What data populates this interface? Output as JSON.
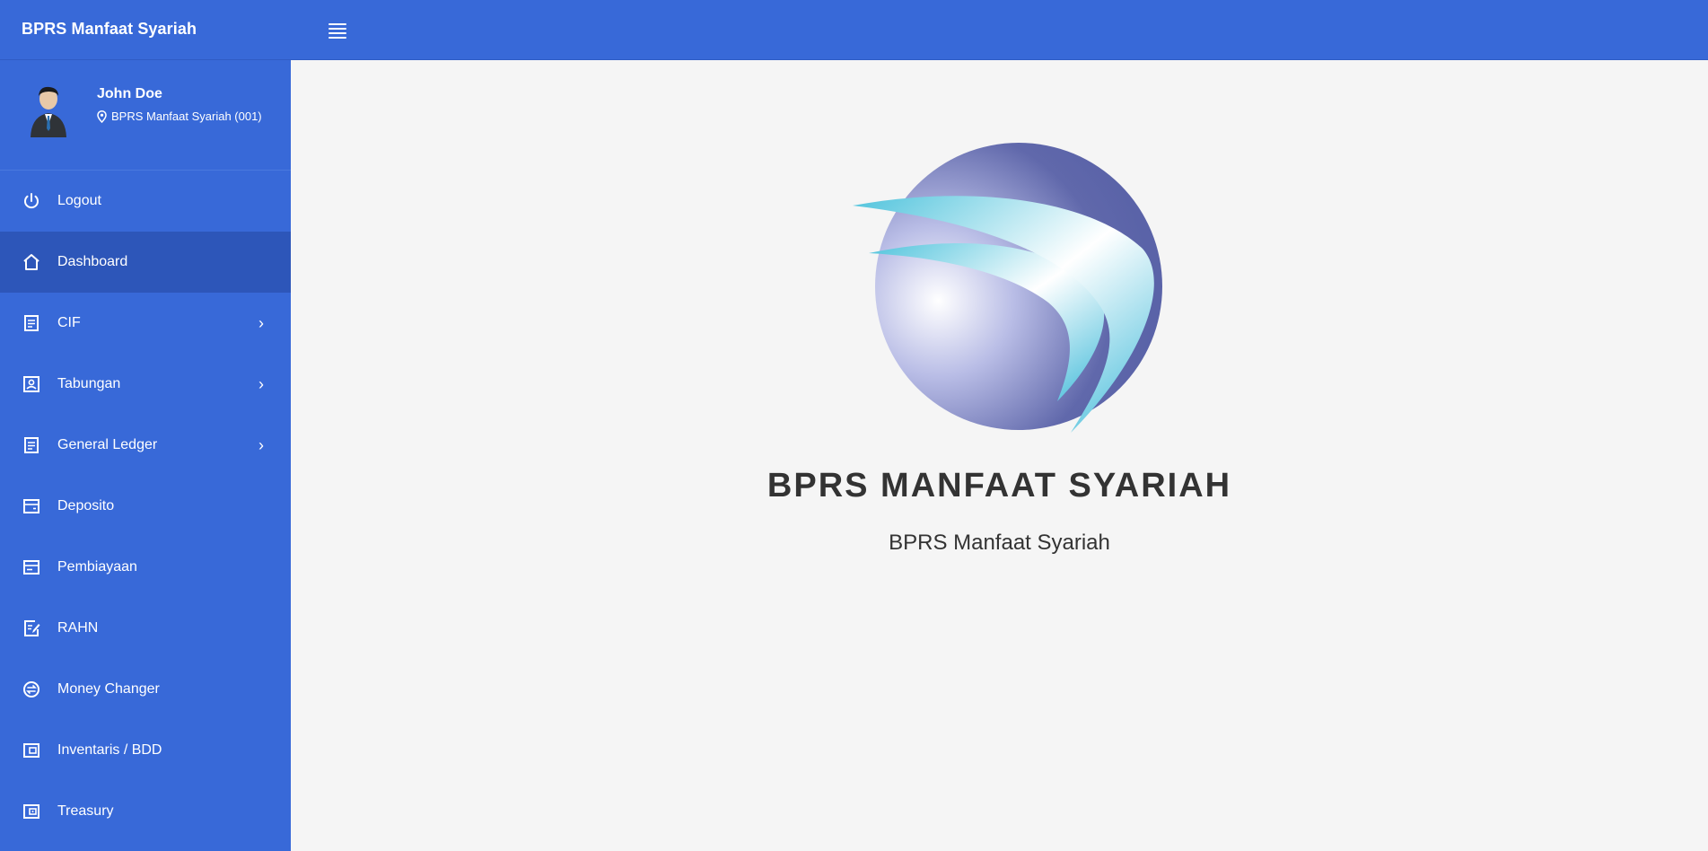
{
  "app": {
    "brand": "BPRS Manfaat Syariah"
  },
  "user": {
    "name": "John Doe",
    "branch": "BPRS Manfaat Syariah (001)"
  },
  "menu": [
    {
      "label": "Logout",
      "icon": "power-icon",
      "has_submenu": false,
      "active": false
    },
    {
      "label": "Dashboard",
      "icon": "home-icon",
      "has_submenu": false,
      "active": true
    },
    {
      "label": "CIF",
      "icon": "document-icon",
      "has_submenu": true,
      "active": false
    },
    {
      "label": "Tabungan",
      "icon": "savings-icon",
      "has_submenu": true,
      "active": false
    },
    {
      "label": "General Ledger",
      "icon": "ledger-icon",
      "has_submenu": true,
      "active": false
    },
    {
      "label": "Deposito",
      "icon": "wallet-icon",
      "has_submenu": false,
      "active": false
    },
    {
      "label": "Pembiayaan",
      "icon": "card-icon",
      "has_submenu": false,
      "active": false
    },
    {
      "label": "RAHN",
      "icon": "edit-document-icon",
      "has_submenu": false,
      "active": false
    },
    {
      "label": "Money Changer",
      "icon": "exchange-icon",
      "has_submenu": false,
      "active": false
    },
    {
      "label": "Inventaris / BDD",
      "icon": "inventory-icon",
      "has_submenu": false,
      "active": false
    },
    {
      "label": "Treasury",
      "icon": "treasury-icon",
      "has_submenu": false,
      "active": false
    }
  ],
  "main": {
    "title": "BPRS MANFAAT SYARIAH",
    "subtitle": "BPRS Manfaat Syariah"
  },
  "colors": {
    "primary": "#3869d8",
    "active": "#2d56b9",
    "background": "#f5f5f5"
  }
}
